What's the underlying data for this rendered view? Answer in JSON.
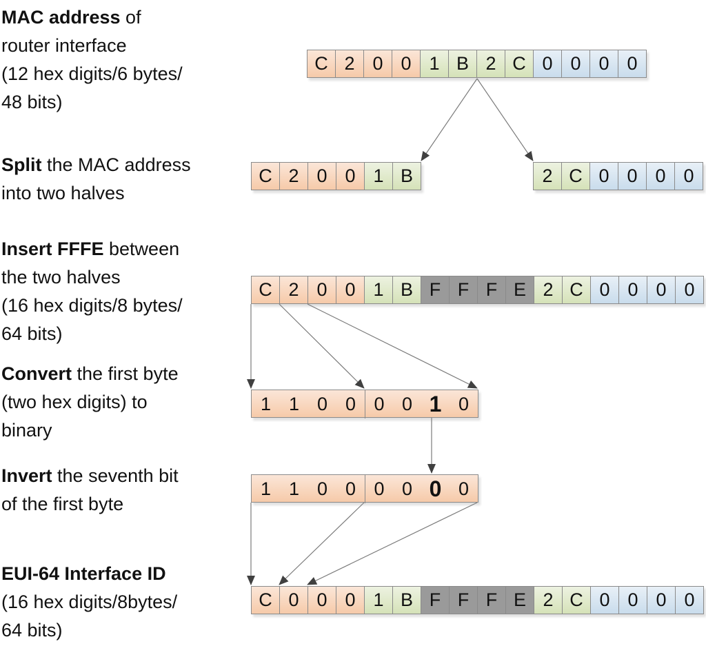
{
  "labels": [
    {
      "bold": "MAC address",
      "rest": " of",
      "lines": [
        "router interface",
        "(12 hex digits/6 bytes/",
        "48 bits)"
      ]
    },
    {
      "bold": "Split",
      "rest": " the MAC address",
      "lines": [
        "into two halves"
      ]
    },
    {
      "bold": "Insert FFFE",
      "rest": " between",
      "lines": [
        "the two halves",
        "(16 hex digits/8 bytes/",
        "64 bits)"
      ]
    },
    {
      "bold": "Convert",
      "rest": " the first byte",
      "lines": [
        "(two hex digits) to",
        "binary"
      ]
    },
    {
      "bold": "Invert",
      "rest": " the seventh bit",
      "lines": [
        "of the first byte"
      ]
    },
    {
      "bold": "EUI-64 Interface ID",
      "rest": "",
      "lines": [
        "(16 hex digits/8bytes/",
        "64 bits)"
      ]
    }
  ],
  "colors": {
    "oui": "#f6caa9",
    "nic_high": "#d5e2b8",
    "nic_low": "#c9dcec",
    "fffe": "#9a9a9a"
  },
  "rows": {
    "mac": [
      {
        "v": "C",
        "c": "orange"
      },
      {
        "v": "2",
        "c": "orange"
      },
      {
        "v": "0",
        "c": "orange"
      },
      {
        "v": "0",
        "c": "orange"
      },
      {
        "v": "1",
        "c": "green"
      },
      {
        "v": "B",
        "c": "green"
      },
      {
        "v": "2",
        "c": "green"
      },
      {
        "v": "C",
        "c": "green"
      },
      {
        "v": "0",
        "c": "blue"
      },
      {
        "v": "0",
        "c": "blue"
      },
      {
        "v": "0",
        "c": "blue"
      },
      {
        "v": "0",
        "c": "blue"
      }
    ],
    "split_left": [
      {
        "v": "C",
        "c": "orange"
      },
      {
        "v": "2",
        "c": "orange"
      },
      {
        "v": "0",
        "c": "orange"
      },
      {
        "v": "0",
        "c": "orange"
      },
      {
        "v": "1",
        "c": "green"
      },
      {
        "v": "B",
        "c": "green"
      }
    ],
    "split_right": [
      {
        "v": "2",
        "c": "green"
      },
      {
        "v": "C",
        "c": "green"
      },
      {
        "v": "0",
        "c": "blue"
      },
      {
        "v": "0",
        "c": "blue"
      },
      {
        "v": "0",
        "c": "blue"
      },
      {
        "v": "0",
        "c": "blue"
      }
    ],
    "fffe": [
      {
        "v": "C",
        "c": "orange"
      },
      {
        "v": "2",
        "c": "orange"
      },
      {
        "v": "0",
        "c": "orange"
      },
      {
        "v": "0",
        "c": "orange"
      },
      {
        "v": "1",
        "c": "green"
      },
      {
        "v": "B",
        "c": "green"
      },
      {
        "v": "F",
        "c": "gray"
      },
      {
        "v": "F",
        "c": "gray"
      },
      {
        "v": "F",
        "c": "gray"
      },
      {
        "v": "E",
        "c": "gray"
      },
      {
        "v": "2",
        "c": "green"
      },
      {
        "v": "C",
        "c": "green"
      },
      {
        "v": "0",
        "c": "blue"
      },
      {
        "v": "0",
        "c": "blue"
      },
      {
        "v": "0",
        "c": "blue"
      },
      {
        "v": "0",
        "c": "blue"
      }
    ],
    "binary": [
      {
        "v": "1"
      },
      {
        "v": "1"
      },
      {
        "v": "0"
      },
      {
        "v": "0"
      },
      {
        "v": "0"
      },
      {
        "v": "0"
      },
      {
        "v": "1",
        "strong": true
      },
      {
        "v": "0"
      }
    ],
    "inverted": [
      {
        "v": "1"
      },
      {
        "v": "1"
      },
      {
        "v": "0"
      },
      {
        "v": "0"
      },
      {
        "v": "0"
      },
      {
        "v": "0"
      },
      {
        "v": "0",
        "strong": true
      },
      {
        "v": "0"
      }
    ],
    "eui64": [
      {
        "v": "C",
        "c": "orange"
      },
      {
        "v": "0",
        "c": "orange"
      },
      {
        "v": "0",
        "c": "orange"
      },
      {
        "v": "0",
        "c": "orange"
      },
      {
        "v": "1",
        "c": "green"
      },
      {
        "v": "B",
        "c": "green"
      },
      {
        "v": "F",
        "c": "gray"
      },
      {
        "v": "F",
        "c": "gray"
      },
      {
        "v": "F",
        "c": "gray"
      },
      {
        "v": "E",
        "c": "gray"
      },
      {
        "v": "2",
        "c": "green"
      },
      {
        "v": "C",
        "c": "green"
      },
      {
        "v": "0",
        "c": "blue"
      },
      {
        "v": "0",
        "c": "blue"
      },
      {
        "v": "0",
        "c": "blue"
      },
      {
        "v": "0",
        "c": "blue"
      }
    ]
  }
}
